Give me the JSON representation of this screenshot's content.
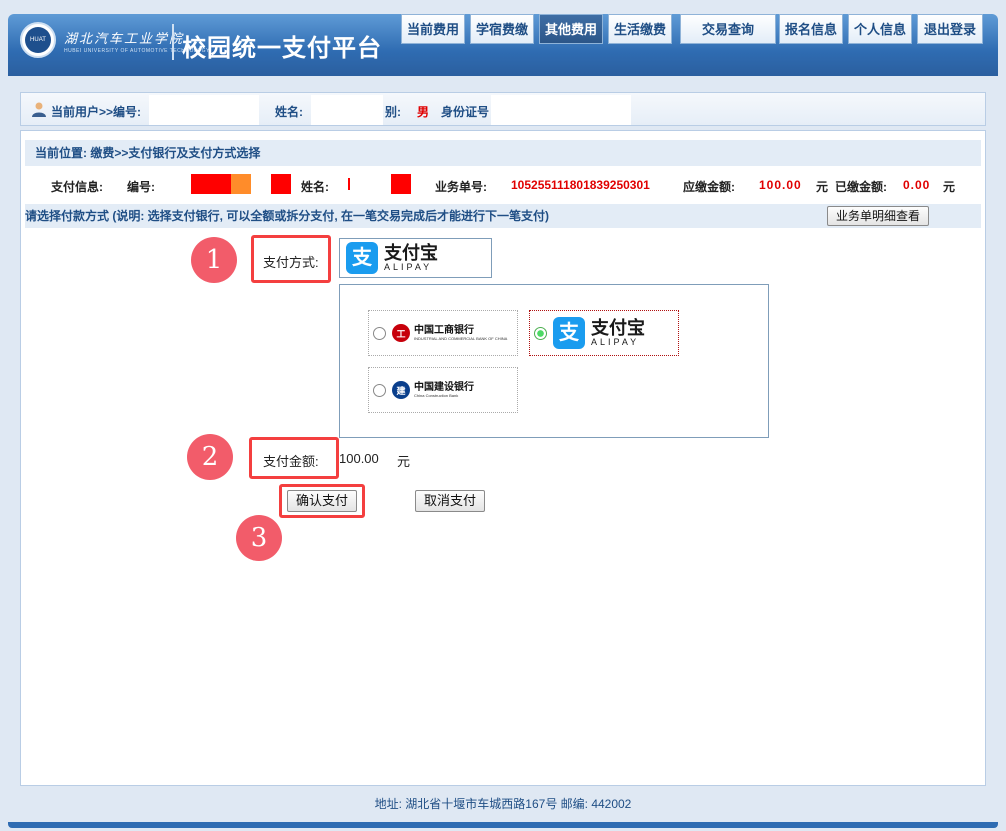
{
  "header": {
    "school_name": "湖北汽车工业学院",
    "school_sub": "HUBEI UNIVERSITY OF AUTOMOTIVE TECHNOLOGY",
    "logo_text": "HUAT",
    "platform_title": "校园统一支付平台"
  },
  "nav": {
    "items": [
      {
        "label": "当前费用"
      },
      {
        "label": "学宿费缴"
      },
      {
        "label": "其他费用"
      },
      {
        "label": "生活缴费"
      },
      {
        "label": "交易查询"
      },
      {
        "label": "报名信息"
      },
      {
        "label": "个人信息"
      },
      {
        "label": "退出登录"
      }
    ],
    "active_index": 2
  },
  "userbar": {
    "current_user": "当前用户>>编号:",
    "name_label": "姓名:",
    "gender_label": "别:",
    "gender_value": "男",
    "id_label": "身份证号"
  },
  "crumb": "当前位置: 缴费>>支付银行及支付方式选择",
  "payinfo": {
    "label": "支付信息:",
    "id_label": "编号:",
    "name_label": "姓名:",
    "order_label": "业务单号:",
    "order_value": "105255111801839250301",
    "due_label": "应缴金额:",
    "due_value": "100.00",
    "unit": "元",
    "paid_label": "已缴金额:",
    "paid_value": "0.00"
  },
  "instruction": "请选择付款方式 (说明: 选择支付银行, 可以全额或拆分支付, 在一笔交易完成后才能进行下一笔支付)",
  "detail_button": "业务单明细查看",
  "pay_method": {
    "label": "支付方式:",
    "selected": "alipay"
  },
  "alipay": {
    "logo": "支",
    "cn": "支付宝",
    "en": "ALIPAY"
  },
  "banks": [
    {
      "name": "中国工商银行",
      "en": "INDUSTRIAL AND COMMERCIAL BANK OF CHINA",
      "color": "#c7000b",
      "selected": false
    },
    {
      "name": "支付宝",
      "en": "ALIPAY",
      "color": "#1a9cef",
      "selected": true
    },
    {
      "name": "中国建设银行",
      "en": "China Construction Bank",
      "color": "#0a3f8c",
      "selected": false
    }
  ],
  "amount": {
    "label": "支付金额:",
    "value": "100.00",
    "unit": "元"
  },
  "buttons": {
    "confirm": "确认支付",
    "cancel": "取消支付"
  },
  "annotations": [
    "1",
    "2",
    "3"
  ],
  "footer": "地址: 湖北省十堰市车城西路167号 邮编: 442002",
  "colors": {
    "header_blue": "#2f6cb2",
    "highlight_red": "#f43f3f",
    "marker_pink": "#f25c6a",
    "amount_red": "#e00000"
  }
}
